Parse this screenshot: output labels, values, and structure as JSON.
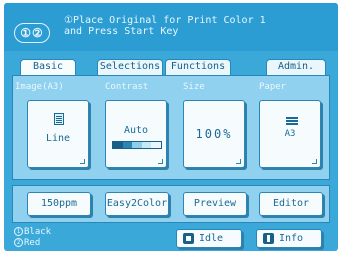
{
  "header": {
    "mode_icon": "1-2-circle-icon",
    "message_num": "1",
    "message_line1": "Place Original for Print Color 1",
    "message_line2": "and Press Start Key"
  },
  "tabs": [
    {
      "label": "Basic",
      "active": true
    },
    {
      "label": "Selections",
      "active": false
    },
    {
      "label": "Functions",
      "active": false
    },
    {
      "label": "Admin.",
      "active": false
    }
  ],
  "settings": {
    "image_label": "Image(A3)",
    "image_value": "Line",
    "contrast_label": "Contrast",
    "contrast_value": "Auto",
    "size_label": "Size",
    "size_value": "100%",
    "paper_label": "Paper",
    "paper_value": "A3"
  },
  "bottom_buttons": [
    {
      "label": "150ppm"
    },
    {
      "label": "Easy2Color"
    },
    {
      "label": "Preview"
    },
    {
      "label": "Editor"
    }
  ],
  "legend": {
    "item1_num": "1",
    "item1": "Black",
    "item2_num": "2",
    "item2": "Red"
  },
  "footer": {
    "idle_label": "Idle",
    "info_label": "Info"
  },
  "colors": {
    "background": "#3aa9da",
    "header": "#2c9dd2",
    "panel": "#8fd1ef",
    "button": "#f6fbfe",
    "text_dark": "#1a6a96"
  }
}
